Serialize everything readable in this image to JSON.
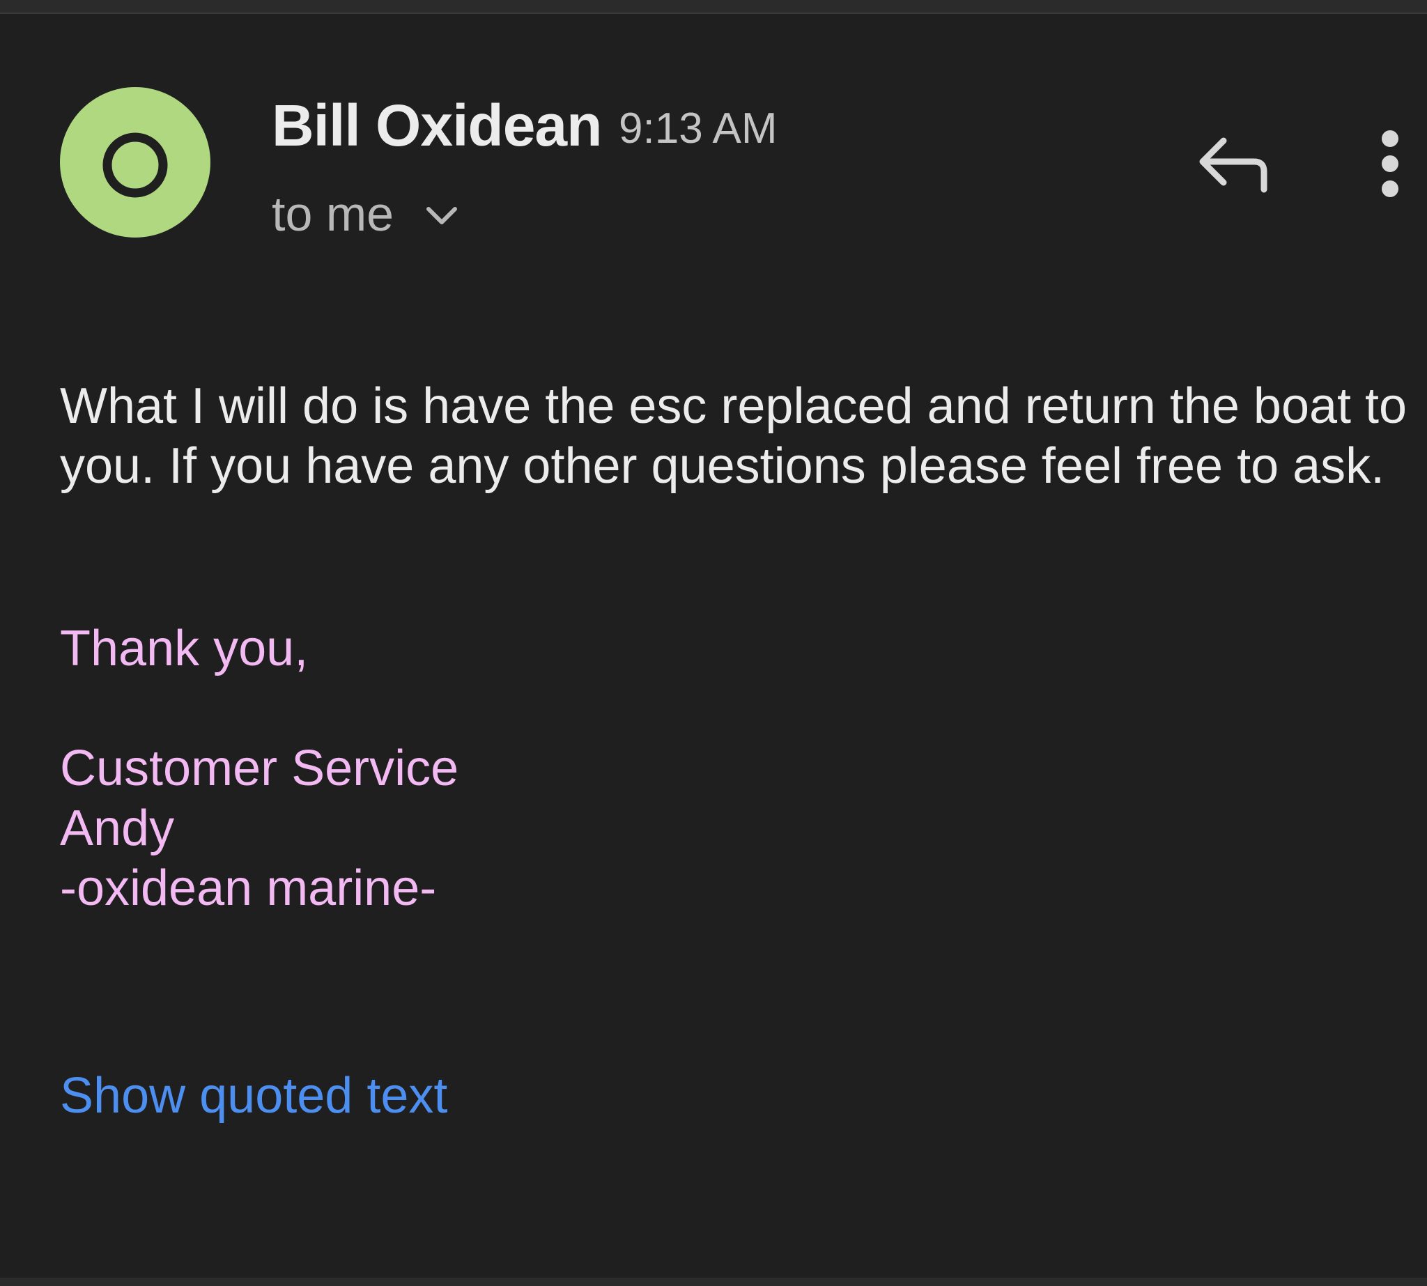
{
  "email": {
    "sender": "Bill Oxidean",
    "time": "9:13 AM",
    "recipient": "to me",
    "body": "What I will do is have the esc replaced and return the boat to you. If you have any other questions please feel free to ask.",
    "signature": {
      "closing": "Thank you,",
      "department": "Customer Service",
      "name": "Andy",
      "company": "-oxidean marine-"
    },
    "show_quoted_label": "Show quoted text"
  },
  "avatar": {
    "letter_shape": "ring-icon",
    "color": "#b0d880"
  },
  "icons": {
    "reply": "reply-arrow-icon",
    "more": "vertical-dots-icon",
    "expand": "chevron-down-icon"
  },
  "colors": {
    "background": "#1f1f1f",
    "signature": "#f2b9f2",
    "link": "#4d8ff0"
  }
}
